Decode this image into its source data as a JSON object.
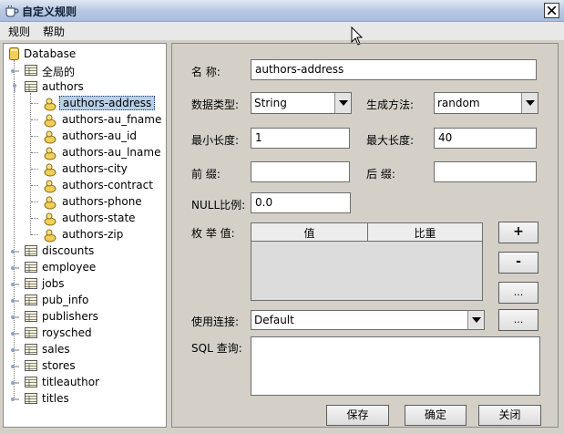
{
  "window": {
    "title": "自定义规则"
  },
  "menu": [
    {
      "label": "规则"
    },
    {
      "label": "帮助"
    }
  ],
  "tree": {
    "root": "Database",
    "items": [
      {
        "label": "全局的"
      },
      {
        "label": "authors",
        "expanded": true,
        "children": [
          "authors-address",
          "authors-au_fname",
          "authors-au_id",
          "authors-au_lname",
          "authors-city",
          "authors-contract",
          "authors-phone",
          "authors-state",
          "authors-zip"
        ]
      },
      {
        "label": "discounts"
      },
      {
        "label": "employee"
      },
      {
        "label": "jobs"
      },
      {
        "label": "pub_info"
      },
      {
        "label": "publishers"
      },
      {
        "label": "roysched"
      },
      {
        "label": "sales"
      },
      {
        "label": "stores"
      },
      {
        "label": "titleauthor"
      },
      {
        "label": "titles"
      }
    ],
    "selected": "authors-address"
  },
  "form": {
    "name_label": "名  称:",
    "name_value": "authors-address",
    "datatype_label": "数据类型:",
    "datatype_value": "String",
    "genmethod_label": "生成方法:",
    "genmethod_value": "random",
    "minlen_label": "最小长度:",
    "minlen_value": "1",
    "maxlen_label": "最大长度:",
    "maxlen_value": "40",
    "prefix_label": "前    缀:",
    "prefix_value": "",
    "suffix_label": "后    缀:",
    "suffix_value": "",
    "nullratio_label": "NULL比例:",
    "nullratio_value": "0.0",
    "enum_label": "枚 举 值:",
    "enum_columns": [
      "值",
      "比重"
    ],
    "add_label": "+",
    "remove_label": "-",
    "more_label": "...",
    "conn_label": "使用连接:",
    "conn_value": "Default",
    "conn_more_label": "...",
    "sql_label": "SQL 查询:",
    "sql_value": ""
  },
  "buttons": {
    "save": "保存",
    "ok": "确定",
    "close": "关闭"
  }
}
